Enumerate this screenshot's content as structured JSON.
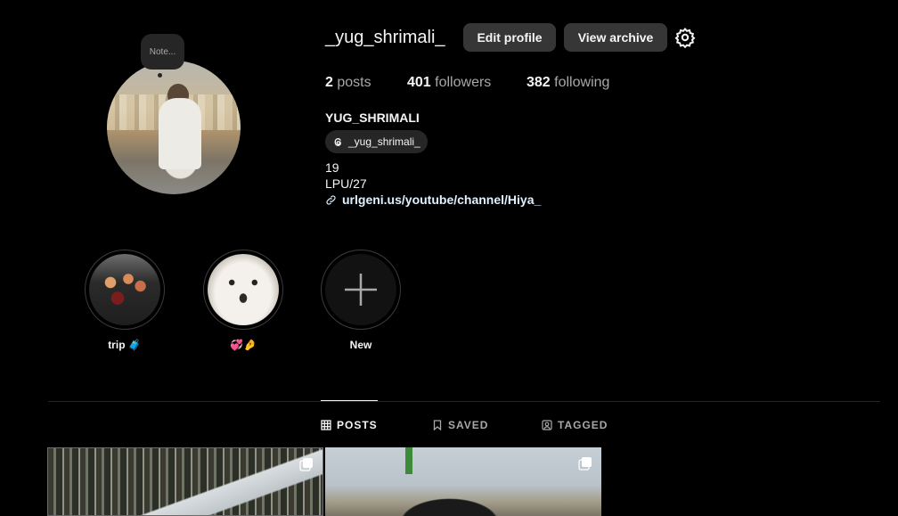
{
  "profile": {
    "note": "Note...",
    "username": "_yug_shrimali_",
    "edit_label": "Edit profile",
    "archive_label": "View archive",
    "stats": {
      "posts_count": "2",
      "posts_label": "posts",
      "followers_count": "401",
      "followers_label": "followers",
      "following_count": "382",
      "following_label": "following"
    },
    "full_name": "YUG_SHRIMALI",
    "threads_handle": "_yug_shrimali_",
    "bio_line1": "19",
    "bio_line2": "LPU/27",
    "link": "urlgeni.us/youtube/channel/Hiya_"
  },
  "highlights": [
    {
      "label": "trip 🧳"
    },
    {
      "label": "💞🤌"
    },
    {
      "label": "New"
    }
  ],
  "tabs": [
    {
      "label": "POSTS",
      "icon": "grid-icon",
      "active": true
    },
    {
      "label": "SAVED",
      "icon": "bookmark-icon",
      "active": false
    },
    {
      "label": "TAGGED",
      "icon": "tag-user-icon",
      "active": false
    }
  ],
  "colors": {
    "background": "#000000",
    "button": "#363636",
    "link": "#e0f1ff"
  }
}
